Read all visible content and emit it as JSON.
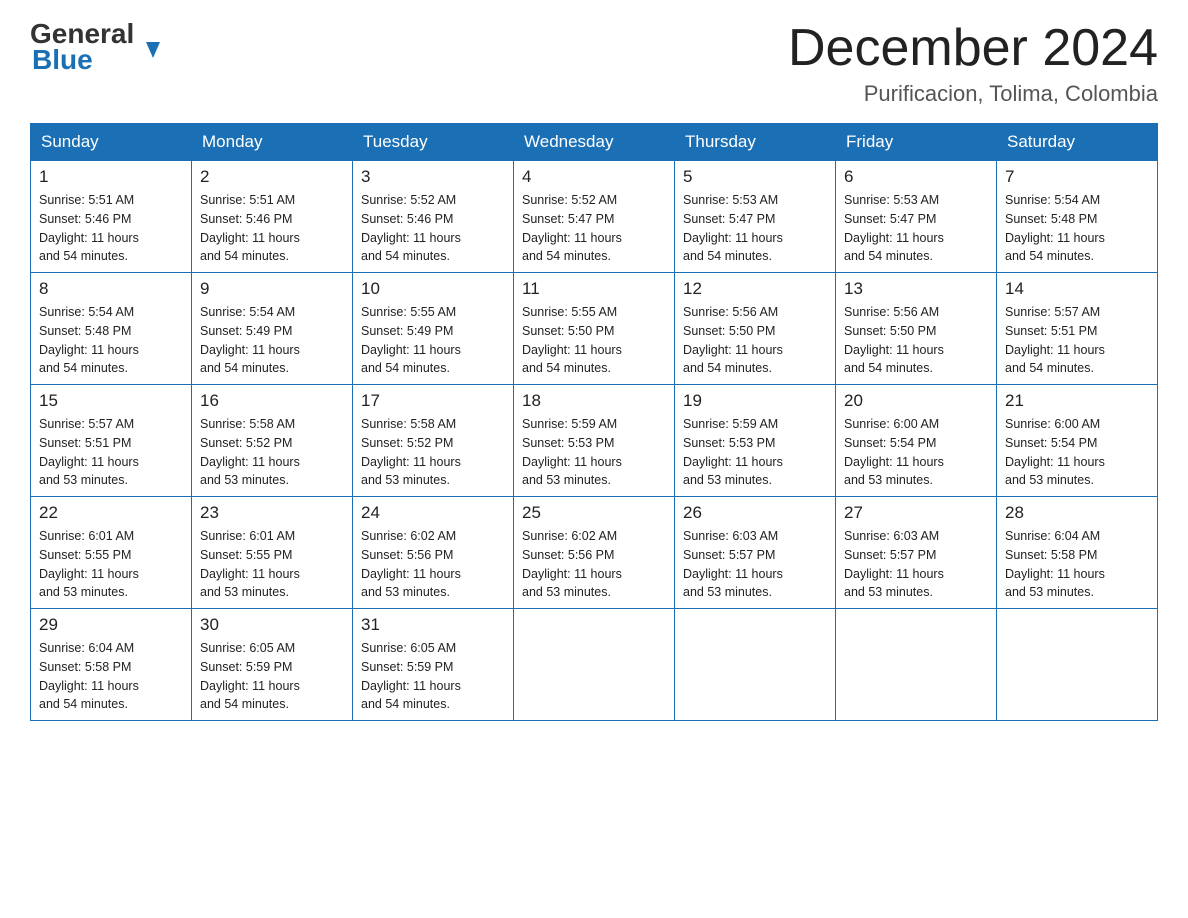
{
  "logo": {
    "general": "General",
    "arrow": "▶",
    "blue": "Blue"
  },
  "header": {
    "month_year": "December 2024",
    "subtitle": "Purificacion, Tolima, Colombia"
  },
  "weekdays": [
    "Sunday",
    "Monday",
    "Tuesday",
    "Wednesday",
    "Thursday",
    "Friday",
    "Saturday"
  ],
  "weeks": [
    [
      {
        "day": "1",
        "sunrise": "5:51 AM",
        "sunset": "5:46 PM",
        "daylight": "11 hours and 54 minutes."
      },
      {
        "day": "2",
        "sunrise": "5:51 AM",
        "sunset": "5:46 PM",
        "daylight": "11 hours and 54 minutes."
      },
      {
        "day": "3",
        "sunrise": "5:52 AM",
        "sunset": "5:46 PM",
        "daylight": "11 hours and 54 minutes."
      },
      {
        "day": "4",
        "sunrise": "5:52 AM",
        "sunset": "5:47 PM",
        "daylight": "11 hours and 54 minutes."
      },
      {
        "day": "5",
        "sunrise": "5:53 AM",
        "sunset": "5:47 PM",
        "daylight": "11 hours and 54 minutes."
      },
      {
        "day": "6",
        "sunrise": "5:53 AM",
        "sunset": "5:47 PM",
        "daylight": "11 hours and 54 minutes."
      },
      {
        "day": "7",
        "sunrise": "5:54 AM",
        "sunset": "5:48 PM",
        "daylight": "11 hours and 54 minutes."
      }
    ],
    [
      {
        "day": "8",
        "sunrise": "5:54 AM",
        "sunset": "5:48 PM",
        "daylight": "11 hours and 54 minutes."
      },
      {
        "day": "9",
        "sunrise": "5:54 AM",
        "sunset": "5:49 PM",
        "daylight": "11 hours and 54 minutes."
      },
      {
        "day": "10",
        "sunrise": "5:55 AM",
        "sunset": "5:49 PM",
        "daylight": "11 hours and 54 minutes."
      },
      {
        "day": "11",
        "sunrise": "5:55 AM",
        "sunset": "5:50 PM",
        "daylight": "11 hours and 54 minutes."
      },
      {
        "day": "12",
        "sunrise": "5:56 AM",
        "sunset": "5:50 PM",
        "daylight": "11 hours and 54 minutes."
      },
      {
        "day": "13",
        "sunrise": "5:56 AM",
        "sunset": "5:50 PM",
        "daylight": "11 hours and 54 minutes."
      },
      {
        "day": "14",
        "sunrise": "5:57 AM",
        "sunset": "5:51 PM",
        "daylight": "11 hours and 54 minutes."
      }
    ],
    [
      {
        "day": "15",
        "sunrise": "5:57 AM",
        "sunset": "5:51 PM",
        "daylight": "11 hours and 53 minutes."
      },
      {
        "day": "16",
        "sunrise": "5:58 AM",
        "sunset": "5:52 PM",
        "daylight": "11 hours and 53 minutes."
      },
      {
        "day": "17",
        "sunrise": "5:58 AM",
        "sunset": "5:52 PM",
        "daylight": "11 hours and 53 minutes."
      },
      {
        "day": "18",
        "sunrise": "5:59 AM",
        "sunset": "5:53 PM",
        "daylight": "11 hours and 53 minutes."
      },
      {
        "day": "19",
        "sunrise": "5:59 AM",
        "sunset": "5:53 PM",
        "daylight": "11 hours and 53 minutes."
      },
      {
        "day": "20",
        "sunrise": "6:00 AM",
        "sunset": "5:54 PM",
        "daylight": "11 hours and 53 minutes."
      },
      {
        "day": "21",
        "sunrise": "6:00 AM",
        "sunset": "5:54 PM",
        "daylight": "11 hours and 53 minutes."
      }
    ],
    [
      {
        "day": "22",
        "sunrise": "6:01 AM",
        "sunset": "5:55 PM",
        "daylight": "11 hours and 53 minutes."
      },
      {
        "day": "23",
        "sunrise": "6:01 AM",
        "sunset": "5:55 PM",
        "daylight": "11 hours and 53 minutes."
      },
      {
        "day": "24",
        "sunrise": "6:02 AM",
        "sunset": "5:56 PM",
        "daylight": "11 hours and 53 minutes."
      },
      {
        "day": "25",
        "sunrise": "6:02 AM",
        "sunset": "5:56 PM",
        "daylight": "11 hours and 53 minutes."
      },
      {
        "day": "26",
        "sunrise": "6:03 AM",
        "sunset": "5:57 PM",
        "daylight": "11 hours and 53 minutes."
      },
      {
        "day": "27",
        "sunrise": "6:03 AM",
        "sunset": "5:57 PM",
        "daylight": "11 hours and 53 minutes."
      },
      {
        "day": "28",
        "sunrise": "6:04 AM",
        "sunset": "5:58 PM",
        "daylight": "11 hours and 53 minutes."
      }
    ],
    [
      {
        "day": "29",
        "sunrise": "6:04 AM",
        "sunset": "5:58 PM",
        "daylight": "11 hours and 54 minutes."
      },
      {
        "day": "30",
        "sunrise": "6:05 AM",
        "sunset": "5:59 PM",
        "daylight": "11 hours and 54 minutes."
      },
      {
        "day": "31",
        "sunrise": "6:05 AM",
        "sunset": "5:59 PM",
        "daylight": "11 hours and 54 minutes."
      },
      null,
      null,
      null,
      null
    ]
  ],
  "labels": {
    "sunrise": "Sunrise:",
    "sunset": "Sunset:",
    "daylight": "Daylight:"
  }
}
